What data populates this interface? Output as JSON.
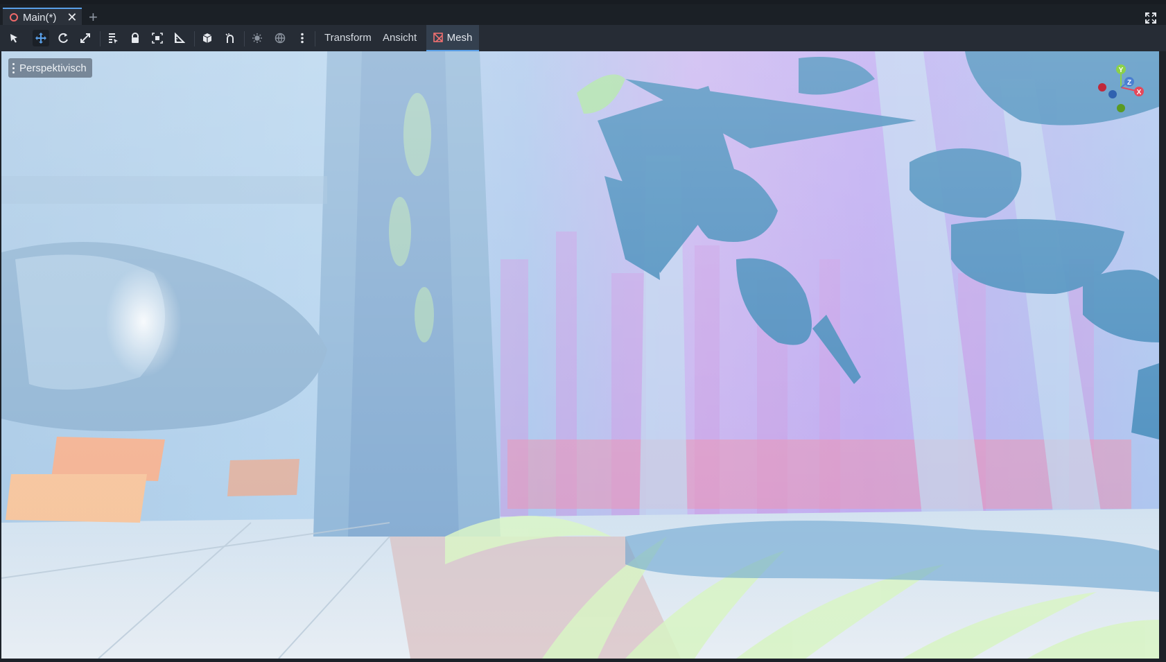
{
  "tabs": [
    {
      "label": "Main(*)",
      "modified": true
    }
  ],
  "tabbar": {
    "add_icon": "plus-icon",
    "fullscreen_icon": "expand-icon"
  },
  "toolbar": {
    "tools": [
      {
        "name": "select-tool",
        "icon": "arrow-cursor-icon",
        "active": false
      },
      {
        "name": "move-tool",
        "icon": "move-arrows-icon",
        "active": true
      },
      {
        "name": "rotate-tool",
        "icon": "rotate-icon",
        "active": false
      },
      {
        "name": "scale-tool",
        "icon": "scale-icon",
        "active": false
      },
      {
        "name": "list-select-tool",
        "icon": "list-select-icon",
        "active": false
      },
      {
        "name": "lock-tool",
        "icon": "lock-icon",
        "active": false
      },
      {
        "name": "group-tool",
        "icon": "group-icon",
        "active": false
      },
      {
        "name": "ruler-tool",
        "icon": "ruler-icon",
        "active": false
      },
      {
        "name": "local-space-toggle",
        "icon": "cube-icon",
        "active": false
      },
      {
        "name": "snap-toggle",
        "icon": "magnet-icon",
        "active": false
      },
      {
        "name": "sun-preview-toggle",
        "icon": "sun-icon",
        "active": false
      },
      {
        "name": "environment-preview-toggle",
        "icon": "globe-icon",
        "active": false
      },
      {
        "name": "more-options",
        "icon": "kebab-icon",
        "active": false
      }
    ],
    "menus": {
      "transform": "Transform",
      "view": "Ansicht",
      "mesh": "Mesh"
    },
    "accent_color": "#5aa0e8"
  },
  "viewport": {
    "camera_mode_label": "Perspektivisch",
    "gizmo_axes": {
      "x": "X",
      "y": "Y",
      "z": "Z"
    },
    "axis_colors": {
      "x": "#e5485a",
      "y": "#8cd14a",
      "z": "#4a7fd1"
    }
  }
}
